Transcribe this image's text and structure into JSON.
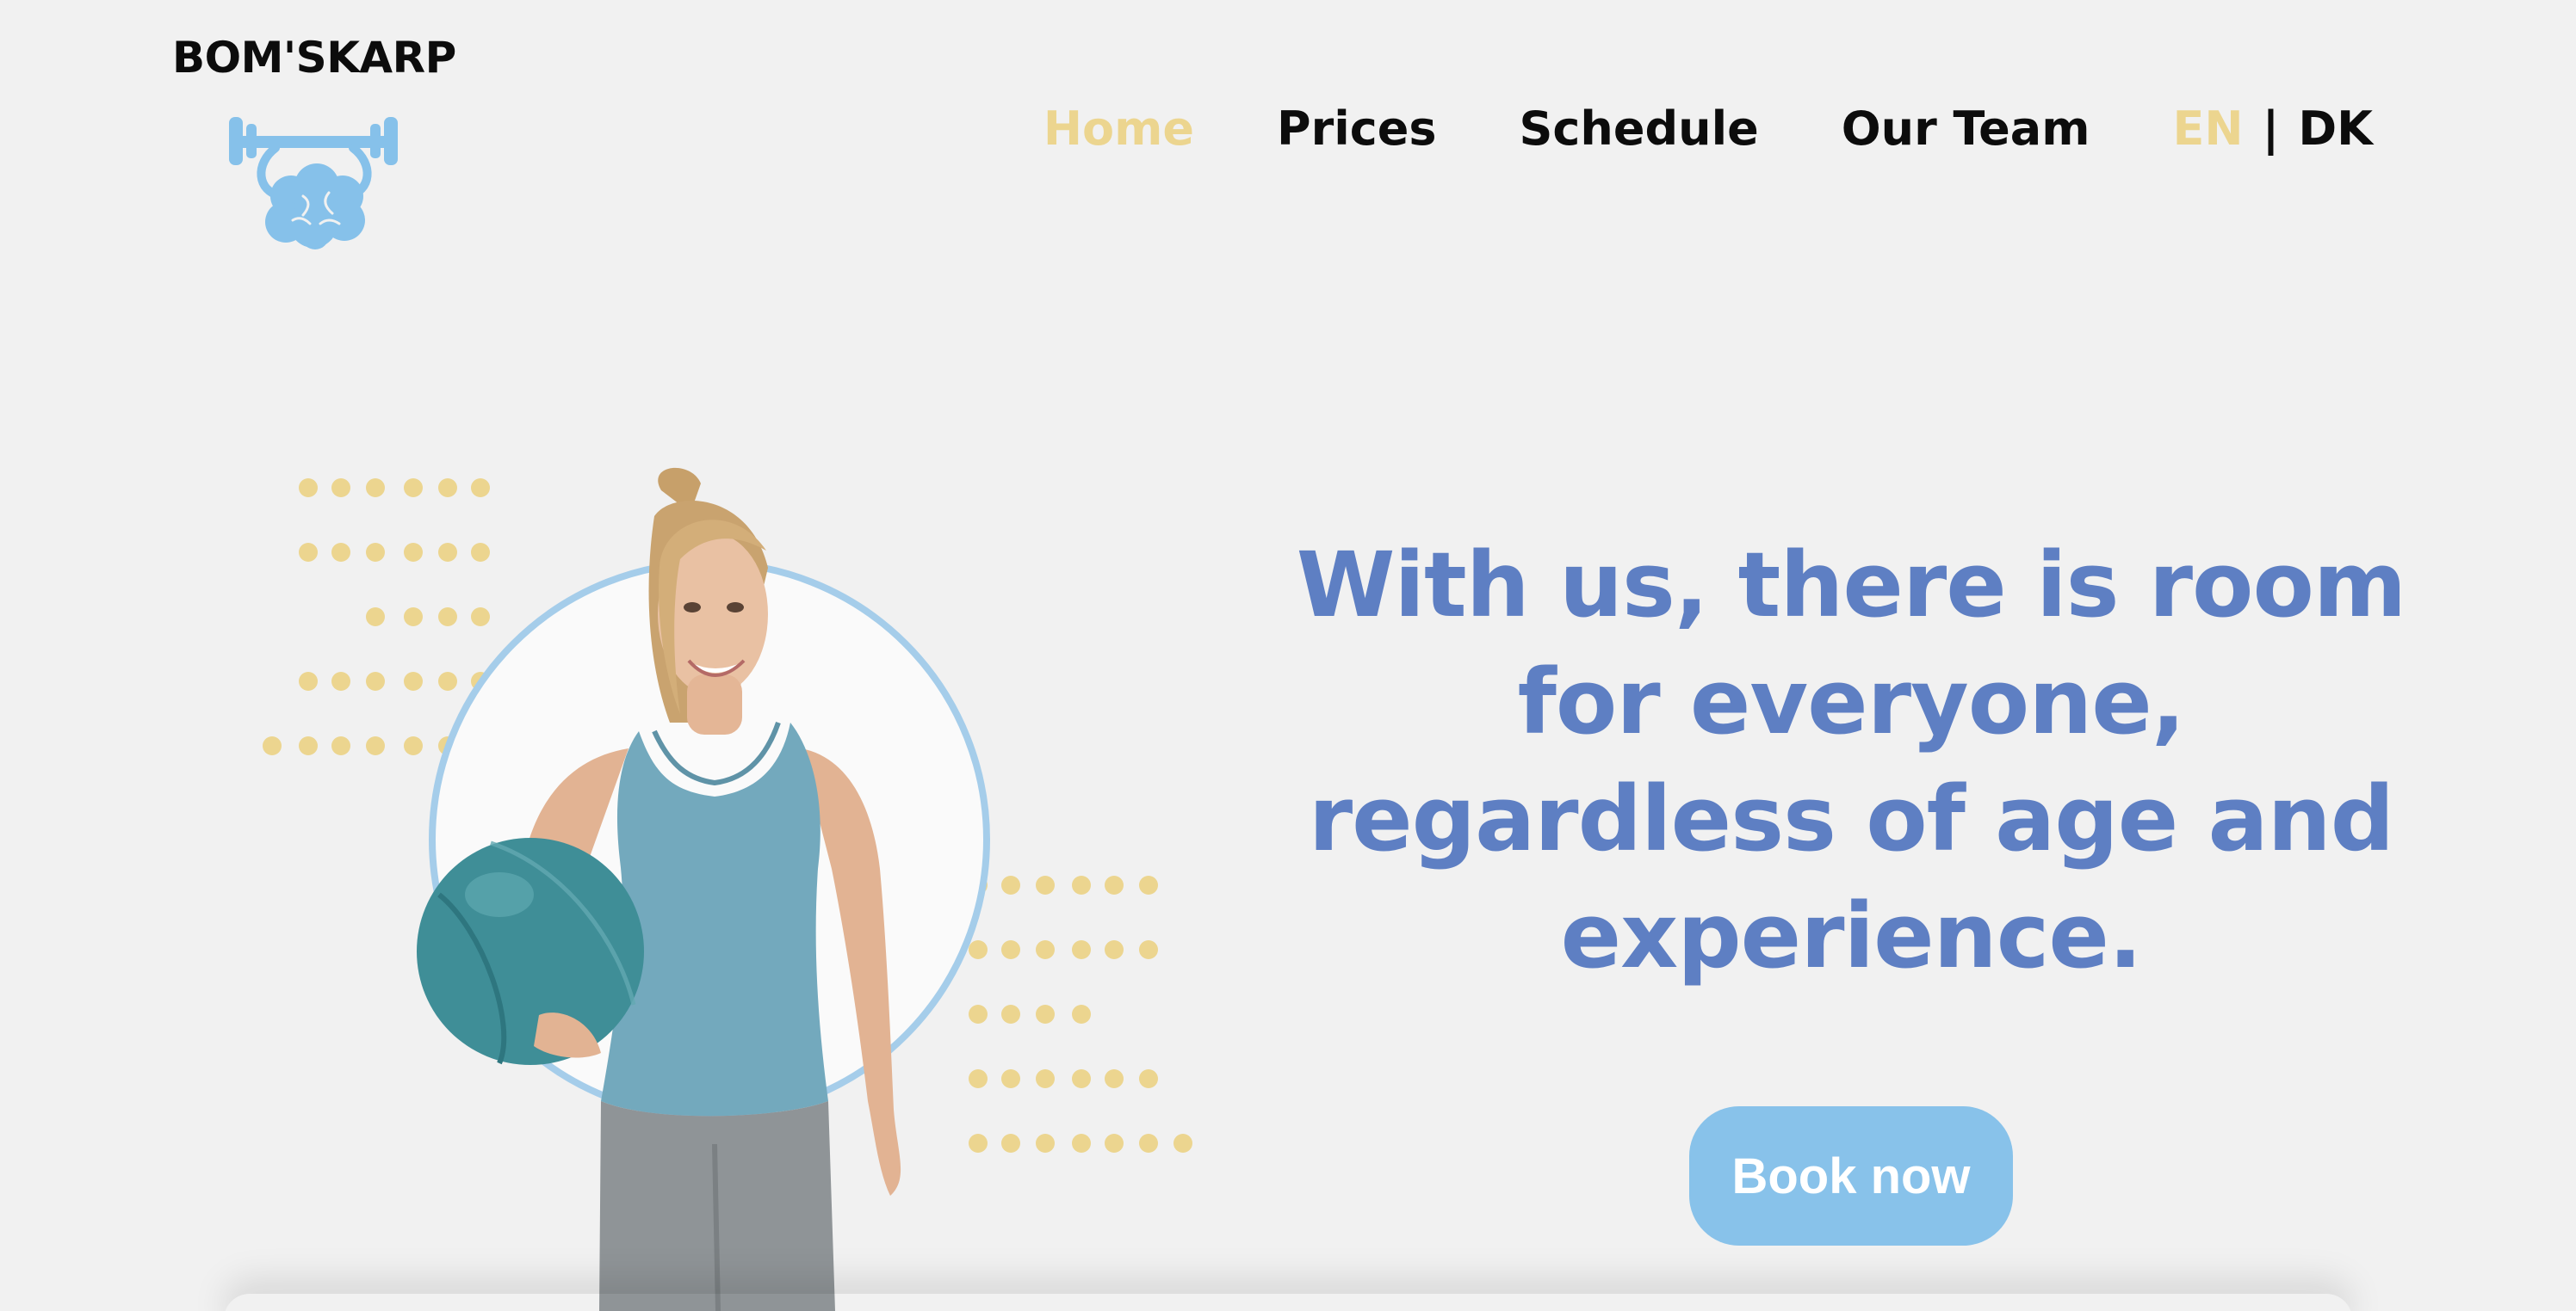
{
  "brand": {
    "name": "BOM'SKARP",
    "logo_icon": "barbell-brain-icon",
    "logo_color": "#86c1ea"
  },
  "nav": {
    "items": [
      {
        "label": "Home",
        "active": true
      },
      {
        "label": "Prices",
        "active": false
      },
      {
        "label": "Schedule",
        "active": false
      },
      {
        "label": "Our Team",
        "active": false
      }
    ],
    "language": {
      "en": "EN",
      "separator": "|",
      "dk": "DK",
      "selected": "EN"
    }
  },
  "hero": {
    "heading": "With us, there is room for everyone, regardless of age and experience.",
    "cta_label": "Book now",
    "image_alt_icon": "woman-holding-exercise-ball-image"
  },
  "colors": {
    "background": "#f1f1f1",
    "accent_yellow": "#ecd58f",
    "heading_blue": "#5e7fc3",
    "button_blue": "#88c2ea",
    "ring_blue": "#a5cdea",
    "text_dark": "#0c0c0c"
  }
}
